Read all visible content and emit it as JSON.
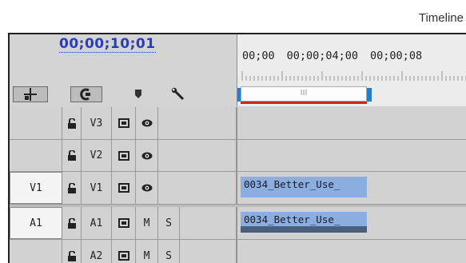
{
  "caption": "Timeline",
  "timecode": "00;00;10;01",
  "ruler": {
    "labels": [
      "00;00",
      "00;00;04;00",
      "00;00;08"
    ]
  },
  "work_area": {
    "handle_text": "III"
  },
  "tracks": [
    {
      "id": "V3",
      "source": "",
      "name": "V3",
      "type": "video",
      "clip": ""
    },
    {
      "id": "V2",
      "source": "",
      "name": "V2",
      "type": "video",
      "clip": ""
    },
    {
      "id": "V1",
      "source": "V1",
      "name": "V1",
      "type": "video",
      "clip": "0034_Better_Use_"
    },
    {
      "id": "A1",
      "source": "A1",
      "name": "A1",
      "type": "audio",
      "m": "M",
      "s": "S",
      "clip": "0034_Better_Use_"
    },
    {
      "id": "A2",
      "source": "",
      "name": "A2",
      "type": "audio",
      "m": "M",
      "s": "S",
      "clip": ""
    }
  ]
}
